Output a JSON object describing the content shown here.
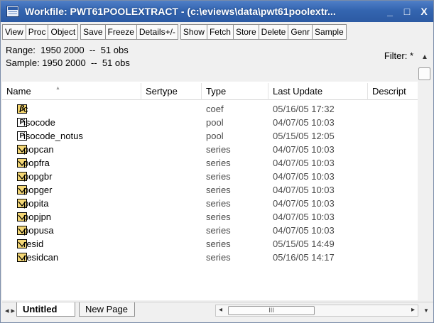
{
  "window": {
    "title": "Workfile: PWT61POOLEXTRACT - (c:\\eviews\\data\\pwt61poolextr...",
    "minimize_label": "_",
    "maximize_label": "□",
    "close_label": "X"
  },
  "toolbar": {
    "buttons": [
      "View",
      "Proc",
      "Object",
      "Save",
      "Freeze",
      "Details+/-",
      "Show",
      "Fetch",
      "Store",
      "Delete",
      "Genr",
      "Sample"
    ]
  },
  "info": {
    "range_line": "Range:  1950 2000  --  51 obs",
    "sample_line": "Sample: 1950 2000  --  51 obs",
    "filter": "Filter: *"
  },
  "columns": [
    "Name",
    "Sertype",
    "Type",
    "Last Update",
    "Descript"
  ],
  "rows": [
    {
      "name": "c",
      "sertype": "",
      "type": "coef",
      "updated": "05/16/05  17:32",
      "icon": "coef-icon"
    },
    {
      "name": "isocode",
      "sertype": "",
      "type": "pool",
      "updated": "04/07/05  10:03",
      "icon": "pool-icon"
    },
    {
      "name": "isocode_notus",
      "sertype": "",
      "type": "pool",
      "updated": "05/15/05  12:05",
      "icon": "pool-icon"
    },
    {
      "name": "popcan",
      "sertype": "",
      "type": "series",
      "updated": "04/07/05  10:03",
      "icon": "series-icon"
    },
    {
      "name": "popfra",
      "sertype": "",
      "type": "series",
      "updated": "04/07/05  10:03",
      "icon": "series-icon"
    },
    {
      "name": "popgbr",
      "sertype": "",
      "type": "series",
      "updated": "04/07/05  10:03",
      "icon": "series-icon"
    },
    {
      "name": "popger",
      "sertype": "",
      "type": "series",
      "updated": "04/07/05  10:03",
      "icon": "series-icon"
    },
    {
      "name": "popita",
      "sertype": "",
      "type": "series",
      "updated": "04/07/05  10:03",
      "icon": "series-icon"
    },
    {
      "name": "popjpn",
      "sertype": "",
      "type": "series",
      "updated": "04/07/05  10:03",
      "icon": "series-icon"
    },
    {
      "name": "popusa",
      "sertype": "",
      "type": "series",
      "updated": "04/07/05  10:03",
      "icon": "series-icon"
    },
    {
      "name": "resid",
      "sertype": "",
      "type": "series",
      "updated": "05/15/05  14:49",
      "icon": "series-icon"
    },
    {
      "name": "residcan",
      "sertype": "",
      "type": "series",
      "updated": "05/16/05  14:17",
      "icon": "series-icon"
    }
  ],
  "icon_glyphs": {
    "coef": "β",
    "pool": "P"
  },
  "tabs": [
    "Untitled",
    "New Page"
  ],
  "hscroll_thumb_glyph": "III",
  "colors": {
    "titlebar": "#3465b0",
    "series_icon_fill": "#f4d775",
    "coef_icon_fill": "#f2d36b"
  }
}
